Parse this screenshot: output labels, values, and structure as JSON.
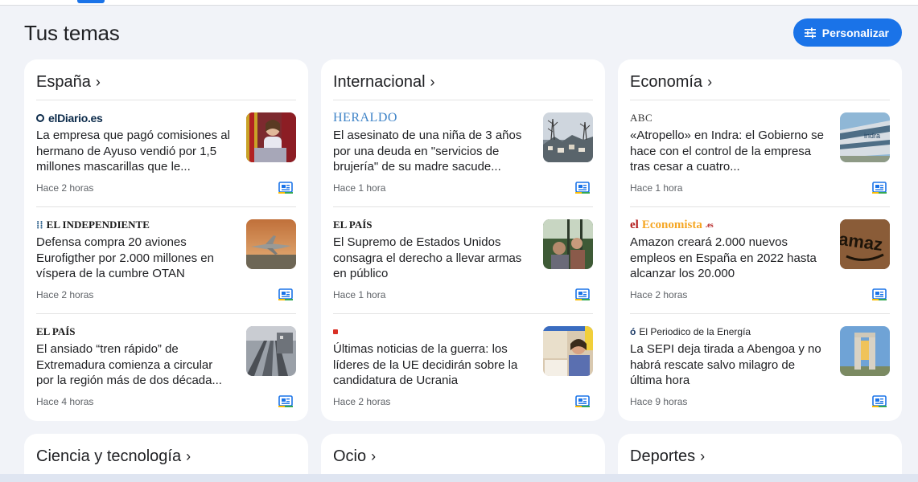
{
  "page": {
    "title": "Tus temas",
    "personalize_label": "Personalizar"
  },
  "cards": [
    {
      "title": "España",
      "stories": [
        {
          "source": "elDiario.es",
          "headline": "La empresa que pagó comisiones al hermano de Ayuso vendió por 1,5 millones mascarillas que le...",
          "time": "Hace 2 horas"
        },
        {
          "source": "EL INDEPENDIENTE",
          "headline": "Defensa compra 20 aviones Eurofigther por 2.000 millones en víspera de la cumbre OTAN",
          "time": "Hace 2 horas"
        },
        {
          "source": "EL PAÍS",
          "headline": "El ansiado “tren rápido” de Extremadura comienza a circular por la región más de dos década...",
          "time": "Hace 4 horas"
        }
      ]
    },
    {
      "title": "Internacional",
      "stories": [
        {
          "source": "HERALDO",
          "headline": "El asesinato de una niña de 3 años por una deuda en \"servicios de brujería\" de su madre sacude...",
          "time": "Hace 1 hora"
        },
        {
          "source": "EL PAÍS",
          "headline": "El Supremo de Estados Unidos consagra el derecho a llevar armas en público",
          "time": "Hace 1 hora"
        },
        {
          "source": "",
          "headline": "Últimas noticias de la guerra: los líderes de la UE decidirán sobre la candidatura de Ucrania",
          "time": "Hace 2 horas"
        }
      ]
    },
    {
      "title": "Economía",
      "stories": [
        {
          "source": "ABC",
          "headline": "«Atropello» en Indra: el Gobierno se hace con el control de la empresa tras cesar a cuatro...",
          "time": "Hace 1 hora"
        },
        {
          "source_a": "el",
          "source_b": "Economista",
          "source_c": ".es",
          "headline": "Amazon creará 2.000 nuevos empleos en España en 2022 hasta alcanzar los 20.000",
          "time": "Hace 2 horas"
        },
        {
          "source": "El Periodico de la Energía",
          "headline": "La SEPI deja tirada a Abengoa y no habrá rescate salvo milagro de última hora",
          "time": "Hace 9 horas"
        }
      ]
    }
  ],
  "bottom_cards": [
    {
      "title": "Ciencia y tecnología"
    },
    {
      "title": "Ocio"
    },
    {
      "title": "Deportes"
    }
  ],
  "icons": {
    "chevron": "chevron-right-icon",
    "full_coverage": "full-coverage-icon",
    "tune": "tune-icon"
  },
  "colors": {
    "accent": "#1a73e8",
    "background": "#f1f3f8",
    "card": "#ffffff"
  }
}
